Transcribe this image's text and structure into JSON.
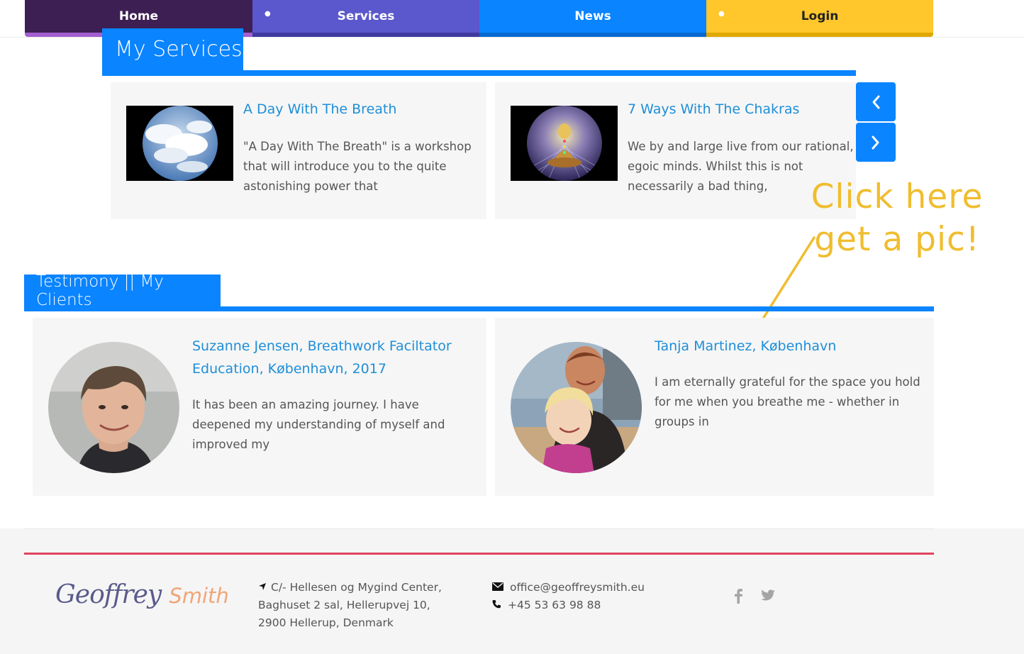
{
  "nav": {
    "items": [
      {
        "label": "Home"
      },
      {
        "label": "Services"
      },
      {
        "label": "News"
      },
      {
        "label": "Login"
      }
    ]
  },
  "services": {
    "title": "My Services",
    "items": [
      {
        "title": "A Day With The Breath",
        "lines": [
          "\"A Day With The Breath\" is a workshop",
          "that will introduce you to the quite",
          "astonishing power that"
        ]
      },
      {
        "title": "7 Ways With The Chakras",
        "lines": [
          "We by and large live from our rational,",
          "egoic minds.  Whilst this is not",
          "necessarily a bad thing,"
        ]
      }
    ],
    "prev_icon": "chevron-left-icon",
    "next_icon": "chevron-right-icon"
  },
  "annotation": {
    "line1": "Click here",
    "line2": "get a pic!",
    "color": "#f0bd2e"
  },
  "testimony": {
    "title": "Testimony || My Clients",
    "items": [
      {
        "name_lines": [
          "Suzanne Jensen, Breathwork Faciltator",
          "Education, København, 2017"
        ],
        "lines": [
          "It has been an amazing journey. I have",
          "deepened my understanding of myself and",
          "improved my"
        ]
      },
      {
        "name_lines": [
          "Tanja Martinez, København"
        ],
        "lines": [
          "I am eternally grateful for the space you hold",
          "for me when you breathe me - whether in",
          "groups in"
        ]
      }
    ]
  },
  "footer": {
    "logo_first": "Geoffrey",
    "logo_last": "Smith",
    "address_lines": [
      "C/- Hellesen og Mygind Center,",
      "Baghuset 2 sal, Hellerupvej 10,",
      "2900 Hellerup, Denmark"
    ],
    "email": "office@geoffreysmith.eu",
    "phone": "+45 53 63 98 88",
    "social": [
      "facebook-icon",
      "twitter-icon"
    ]
  },
  "colors": {
    "nav_home": "#3e1f53",
    "nav_services": "#5b57cc",
    "nav_news": "#0a84ff",
    "nav_login": "#ffc72c",
    "accent": "#0a84ff",
    "link": "#1e8fd8",
    "footer_rule": "#e0445e"
  }
}
